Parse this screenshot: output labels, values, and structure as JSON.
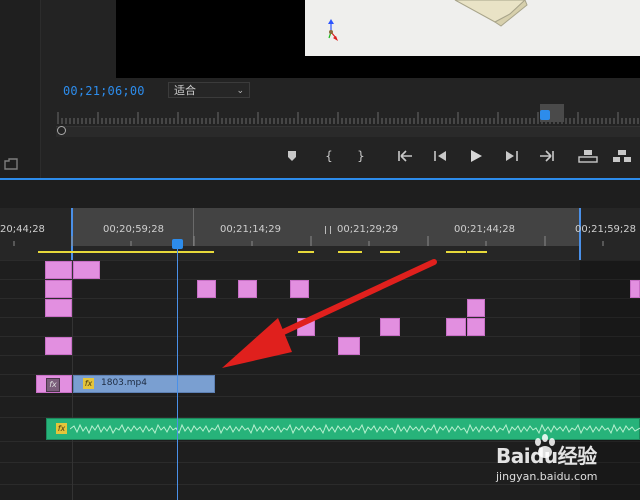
{
  "monitor": {
    "timecode": "00;21;06;00",
    "fit_label": "适合",
    "controls": [
      "add-marker",
      "mark-in",
      "mark-out",
      "go-to-in",
      "step-back",
      "play",
      "step-forward",
      "go-to-out",
      "lift",
      "extract"
    ]
  },
  "timeline": {
    "ruler_ticks": [
      "20;44;28",
      "00;20;59;28",
      "00;21;14;29",
      "00;21;29;29",
      "00;21;44;28",
      "00;21;59;28"
    ],
    "clip_name": "1803.mp4",
    "fx_label": "fx"
  },
  "watermark": {
    "brand": "Baidu经验",
    "url": "jingyan.baidu.com"
  },
  "colors": {
    "accent_blue": "#2d8ceb",
    "clip_pink": "#e28fe0",
    "video_clip": "#7a9fd1",
    "audio_clip": "#27b37a",
    "arrow_red": "#e0201d"
  }
}
